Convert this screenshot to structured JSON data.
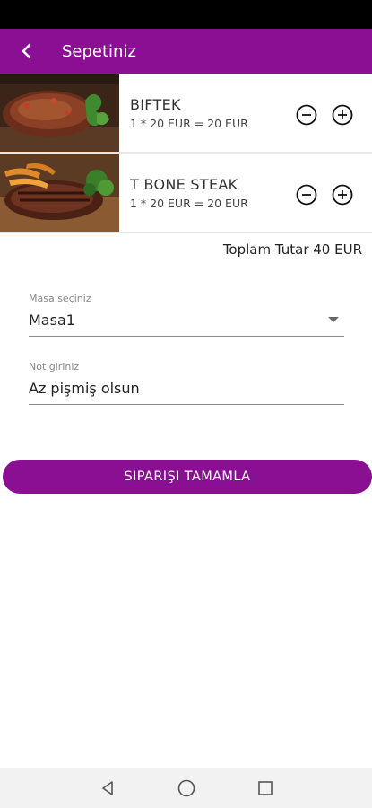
{
  "app_bar": {
    "title": "Sepetiniz",
    "back_icon": "back-chevron-icon",
    "background": "#8a0f93"
  },
  "cart": {
    "items": [
      {
        "name": "BIFTEK",
        "price_line": "1 * 20 EUR = 20 EUR",
        "image": "steak-photo"
      },
      {
        "name": "T BONE STEAK",
        "price_line": "1 * 20 EUR = 20 EUR",
        "image": "t-bone-steak-photo"
      }
    ],
    "minus_icon": "minus-circle-icon",
    "plus_icon": "plus-circle-icon"
  },
  "total_text": "Toplam Tutar 40 EUR",
  "table_select": {
    "label": "Masa seçiniz",
    "value": "Masa1"
  },
  "note_field": {
    "label": "Not giriniz",
    "value": "Az pişmiş olsun"
  },
  "submit_button": {
    "label": "SIPARIŞI TAMAMLA"
  },
  "nav": {
    "back": "nav-back-icon",
    "home": "nav-home-icon",
    "recents": "nav-recents-icon"
  },
  "colors": {
    "accent": "#8a0f93"
  }
}
